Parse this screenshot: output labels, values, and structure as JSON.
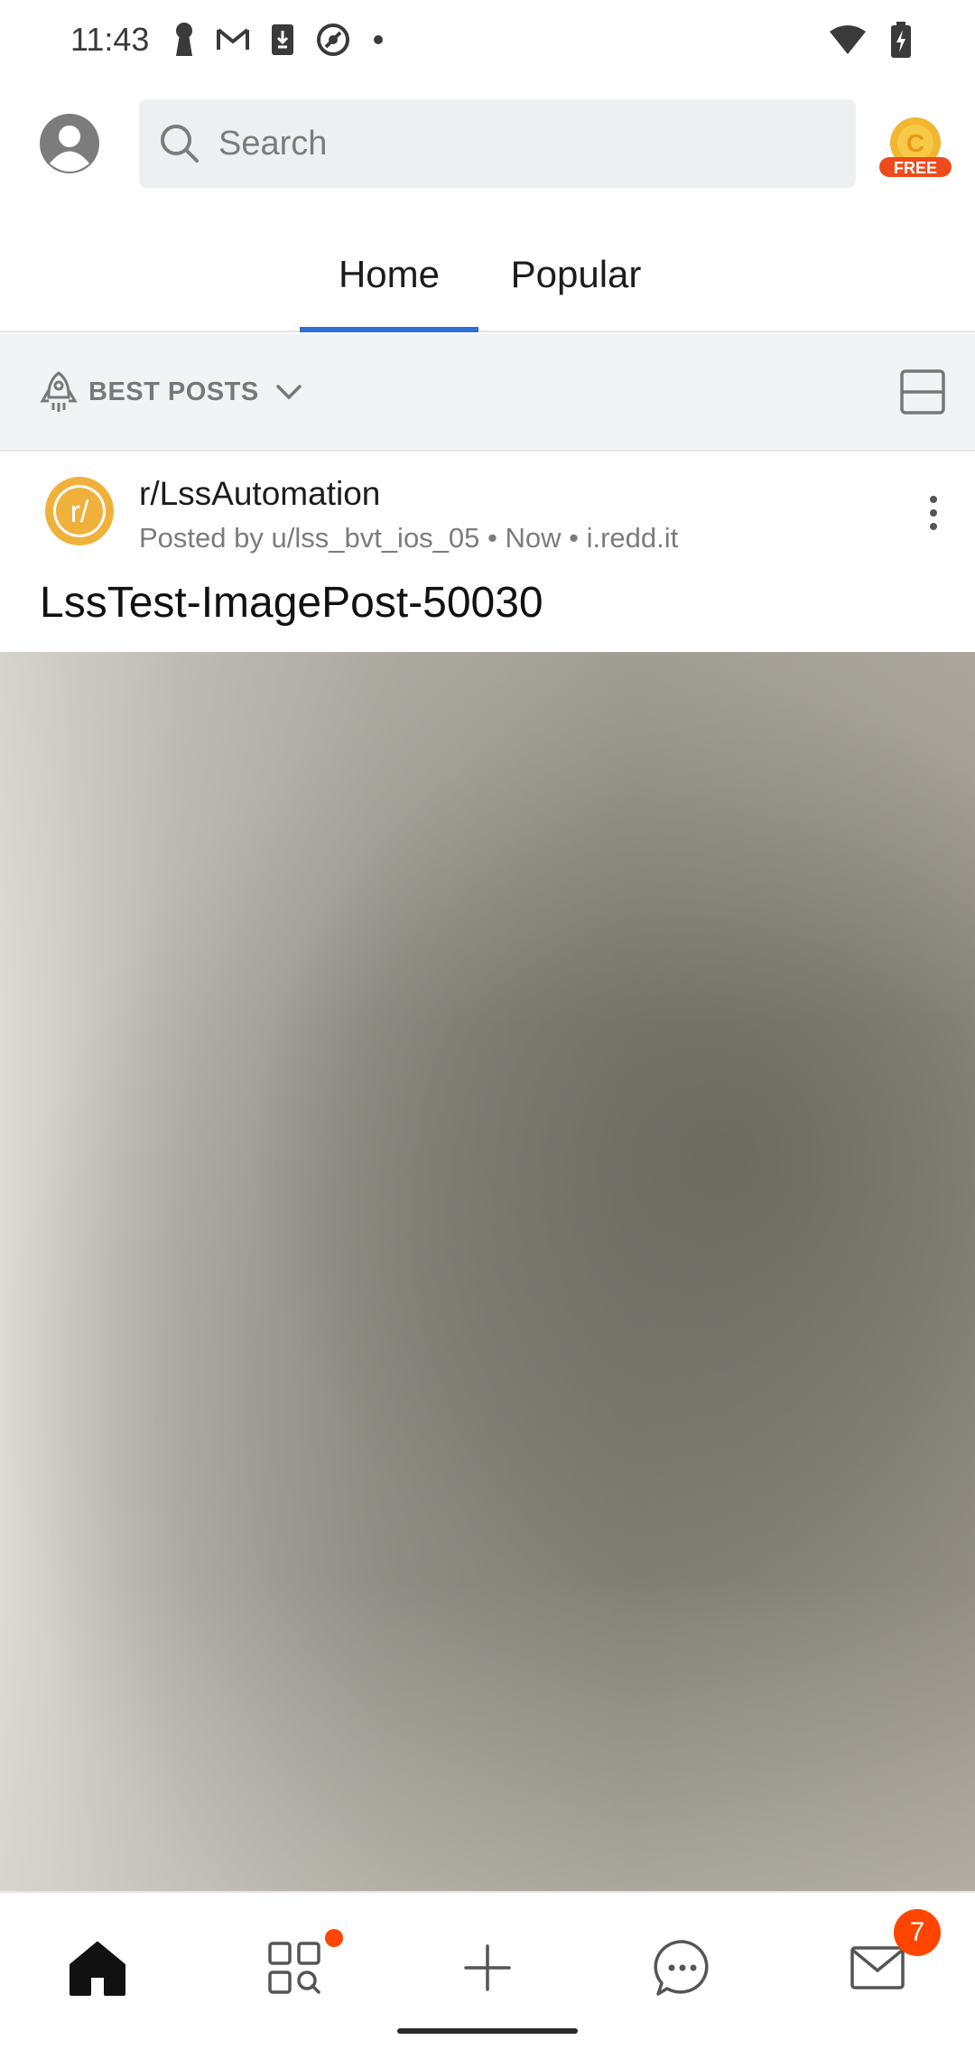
{
  "status_bar": {
    "time": "11:43",
    "left_icons": [
      "keyhole-icon",
      "gmail-icon",
      "download-icon",
      "at-sign-icon",
      "dot-icon"
    ],
    "right_icons": [
      "wifi-icon",
      "battery-charging-icon"
    ]
  },
  "header": {
    "search_placeholder": "Search",
    "coin_label": "FREE"
  },
  "tabs": [
    {
      "label": "Home",
      "selected": true
    },
    {
      "label": "Popular",
      "selected": false
    }
  ],
  "sort": {
    "label": "BEST POSTS"
  },
  "post": {
    "subreddit_icon_text": "r/",
    "subreddit": "r/LssAutomation",
    "meta": "Posted by u/lss_bvt_ios_05 • Now • i.redd.it",
    "title": "LssTest-ImagePost-50030"
  },
  "bottom_nav": {
    "items": [
      "home-icon",
      "communities-icon",
      "create-icon",
      "chat-icon",
      "inbox-icon"
    ],
    "inbox_badge": "7"
  },
  "colors": {
    "accent_blue": "#2e6fd8",
    "reddit_orange": "#ff4500",
    "subreddit_yellow": "#f0b13c"
  }
}
